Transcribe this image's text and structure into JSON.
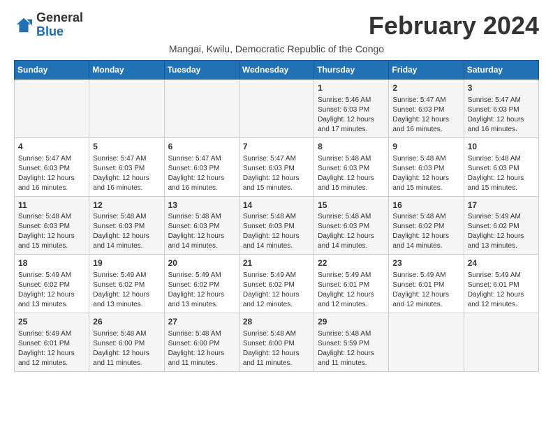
{
  "header": {
    "logo_general": "General",
    "logo_blue": "Blue",
    "month_title": "February 2024",
    "subtitle": "Mangai, Kwilu, Democratic Republic of the Congo"
  },
  "days_of_week": [
    "Sunday",
    "Monday",
    "Tuesday",
    "Wednesday",
    "Thursday",
    "Friday",
    "Saturday"
  ],
  "weeks": [
    [
      {
        "day": "",
        "info": ""
      },
      {
        "day": "",
        "info": ""
      },
      {
        "day": "",
        "info": ""
      },
      {
        "day": "",
        "info": ""
      },
      {
        "day": "1",
        "info": "Sunrise: 5:46 AM\nSunset: 6:03 PM\nDaylight: 12 hours and 17 minutes."
      },
      {
        "day": "2",
        "info": "Sunrise: 5:47 AM\nSunset: 6:03 PM\nDaylight: 12 hours and 16 minutes."
      },
      {
        "day": "3",
        "info": "Sunrise: 5:47 AM\nSunset: 6:03 PM\nDaylight: 12 hours and 16 minutes."
      }
    ],
    [
      {
        "day": "4",
        "info": "Sunrise: 5:47 AM\nSunset: 6:03 PM\nDaylight: 12 hours and 16 minutes."
      },
      {
        "day": "5",
        "info": "Sunrise: 5:47 AM\nSunset: 6:03 PM\nDaylight: 12 hours and 16 minutes."
      },
      {
        "day": "6",
        "info": "Sunrise: 5:47 AM\nSunset: 6:03 PM\nDaylight: 12 hours and 16 minutes."
      },
      {
        "day": "7",
        "info": "Sunrise: 5:47 AM\nSunset: 6:03 PM\nDaylight: 12 hours and 15 minutes."
      },
      {
        "day": "8",
        "info": "Sunrise: 5:48 AM\nSunset: 6:03 PM\nDaylight: 12 hours and 15 minutes."
      },
      {
        "day": "9",
        "info": "Sunrise: 5:48 AM\nSunset: 6:03 PM\nDaylight: 12 hours and 15 minutes."
      },
      {
        "day": "10",
        "info": "Sunrise: 5:48 AM\nSunset: 6:03 PM\nDaylight: 12 hours and 15 minutes."
      }
    ],
    [
      {
        "day": "11",
        "info": "Sunrise: 5:48 AM\nSunset: 6:03 PM\nDaylight: 12 hours and 15 minutes."
      },
      {
        "day": "12",
        "info": "Sunrise: 5:48 AM\nSunset: 6:03 PM\nDaylight: 12 hours and 14 minutes."
      },
      {
        "day": "13",
        "info": "Sunrise: 5:48 AM\nSunset: 6:03 PM\nDaylight: 12 hours and 14 minutes."
      },
      {
        "day": "14",
        "info": "Sunrise: 5:48 AM\nSunset: 6:03 PM\nDaylight: 12 hours and 14 minutes."
      },
      {
        "day": "15",
        "info": "Sunrise: 5:48 AM\nSunset: 6:03 PM\nDaylight: 12 hours and 14 minutes."
      },
      {
        "day": "16",
        "info": "Sunrise: 5:48 AM\nSunset: 6:02 PM\nDaylight: 12 hours and 14 minutes."
      },
      {
        "day": "17",
        "info": "Sunrise: 5:49 AM\nSunset: 6:02 PM\nDaylight: 12 hours and 13 minutes."
      }
    ],
    [
      {
        "day": "18",
        "info": "Sunrise: 5:49 AM\nSunset: 6:02 PM\nDaylight: 12 hours and 13 minutes."
      },
      {
        "day": "19",
        "info": "Sunrise: 5:49 AM\nSunset: 6:02 PM\nDaylight: 12 hours and 13 minutes."
      },
      {
        "day": "20",
        "info": "Sunrise: 5:49 AM\nSunset: 6:02 PM\nDaylight: 12 hours and 13 minutes."
      },
      {
        "day": "21",
        "info": "Sunrise: 5:49 AM\nSunset: 6:02 PM\nDaylight: 12 hours and 12 minutes."
      },
      {
        "day": "22",
        "info": "Sunrise: 5:49 AM\nSunset: 6:01 PM\nDaylight: 12 hours and 12 minutes."
      },
      {
        "day": "23",
        "info": "Sunrise: 5:49 AM\nSunset: 6:01 PM\nDaylight: 12 hours and 12 minutes."
      },
      {
        "day": "24",
        "info": "Sunrise: 5:49 AM\nSunset: 6:01 PM\nDaylight: 12 hours and 12 minutes."
      }
    ],
    [
      {
        "day": "25",
        "info": "Sunrise: 5:49 AM\nSunset: 6:01 PM\nDaylight: 12 hours and 12 minutes."
      },
      {
        "day": "26",
        "info": "Sunrise: 5:48 AM\nSunset: 6:00 PM\nDaylight: 12 hours and 11 minutes."
      },
      {
        "day": "27",
        "info": "Sunrise: 5:48 AM\nSunset: 6:00 PM\nDaylight: 12 hours and 11 minutes."
      },
      {
        "day": "28",
        "info": "Sunrise: 5:48 AM\nSunset: 6:00 PM\nDaylight: 12 hours and 11 minutes."
      },
      {
        "day": "29",
        "info": "Sunrise: 5:48 AM\nSunset: 5:59 PM\nDaylight: 12 hours and 11 minutes."
      },
      {
        "day": "",
        "info": ""
      },
      {
        "day": "",
        "info": ""
      }
    ]
  ]
}
